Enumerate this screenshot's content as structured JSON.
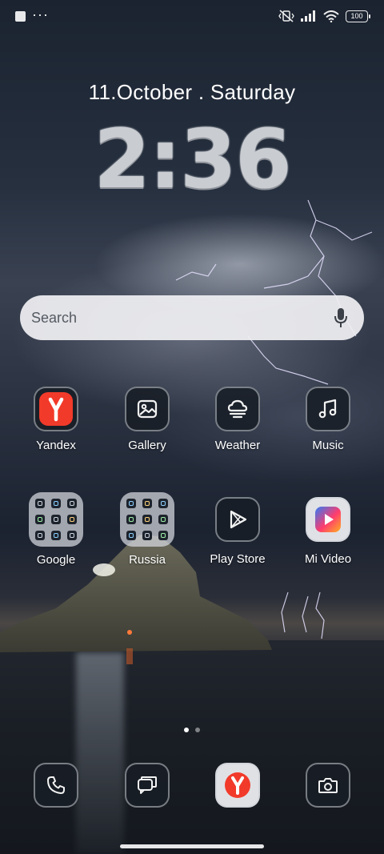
{
  "status_bar": {
    "battery_level": "100",
    "icons": [
      "notification-square-icon",
      "more-dots-icon",
      "vibrate-off-icon",
      "signal-icon",
      "wifi-icon",
      "battery-icon"
    ],
    "more_label": "···"
  },
  "clock": {
    "date": "11.October . Saturday",
    "time": "2:36"
  },
  "search": {
    "placeholder": "Search",
    "mic_icon": "mic-icon"
  },
  "apps_row1": [
    {
      "label": "Yandex",
      "icon": "yandex-icon"
    },
    {
      "label": "Gallery",
      "icon": "gallery-icon"
    },
    {
      "label": "Weather",
      "icon": "weather-icon"
    },
    {
      "label": "Music",
      "icon": "music-icon"
    }
  ],
  "apps_row2": [
    {
      "label": "Google",
      "icon": "folder-icon"
    },
    {
      "label": "Russia",
      "icon": "folder-icon"
    },
    {
      "label": "Play Store",
      "icon": "play-store-icon"
    },
    {
      "label": "Mi Video",
      "icon": "mi-video-icon"
    }
  ],
  "page_indicator": {
    "pages": 2,
    "current": 1
  },
  "dock": [
    {
      "icon": "phone-icon"
    },
    {
      "icon": "messages-icon"
    },
    {
      "icon": "yandex-browser-icon"
    },
    {
      "icon": "camera-icon"
    }
  ],
  "colors": {
    "yandex_red": "#f23a2a",
    "mi_video_gradient": [
      "#2f7cf6",
      "#ff3c6e",
      "#ffb020"
    ]
  }
}
